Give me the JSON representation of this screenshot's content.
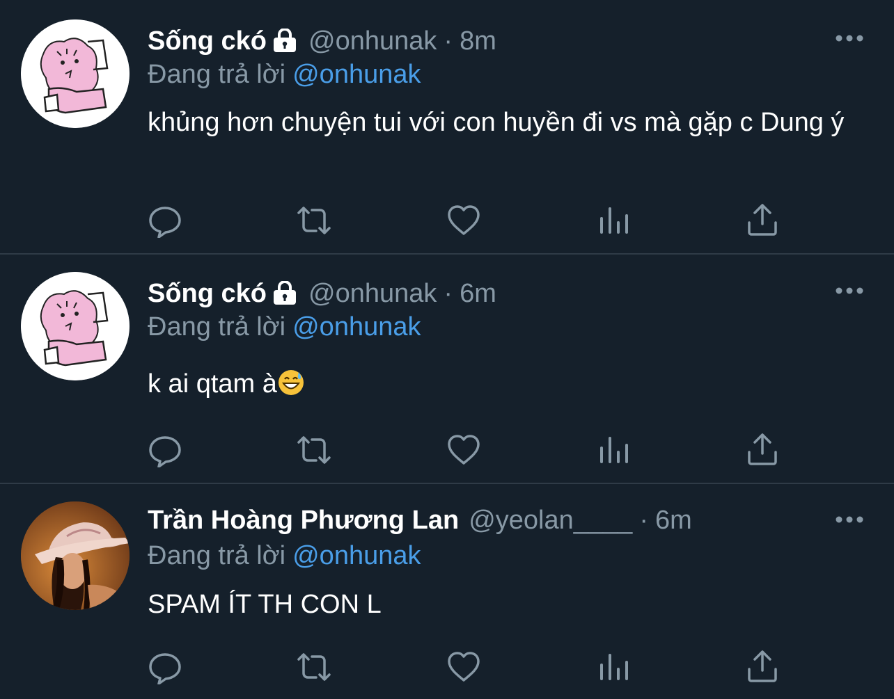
{
  "tweets": [
    {
      "name": "Sống ckó",
      "handle": "@onhunak",
      "sep": "·",
      "time": "8m",
      "replying_label": "Đang trả lời",
      "replying_to": "@onhunak",
      "text": "khủng hơn chuyện tui với con huyền đi vs mà gặp c Dung ý",
      "protected": true,
      "avatar": "pink-cat-sketch"
    },
    {
      "name": "Sống ckó",
      "handle": "@onhunak",
      "sep": "·",
      "time": "6m",
      "replying_label": "Đang trả lời",
      "replying_to": "@onhunak",
      "text": "k ai qtam à",
      "emoji": "grinning-sweat-emoji",
      "protected": true,
      "avatar": "pink-cat-sketch"
    },
    {
      "name": "Trần Hoàng Phương Lan",
      "handle": "@yeolan____",
      "sep": "·",
      "time": "6m",
      "replying_label": "Đang trả lời",
      "replying_to": "@onhunak",
      "text": "SPAM ÍT TH CON L",
      "protected": false,
      "avatar": "cowboy-hat-photo"
    }
  ],
  "actions": [
    "reply-icon",
    "retweet-icon",
    "like-icon",
    "analytics-icon",
    "share-icon"
  ],
  "colors": {
    "background": "#15202b",
    "muted": "#8899a6",
    "link": "#4a9ee8",
    "divider": "#2f3b47"
  }
}
